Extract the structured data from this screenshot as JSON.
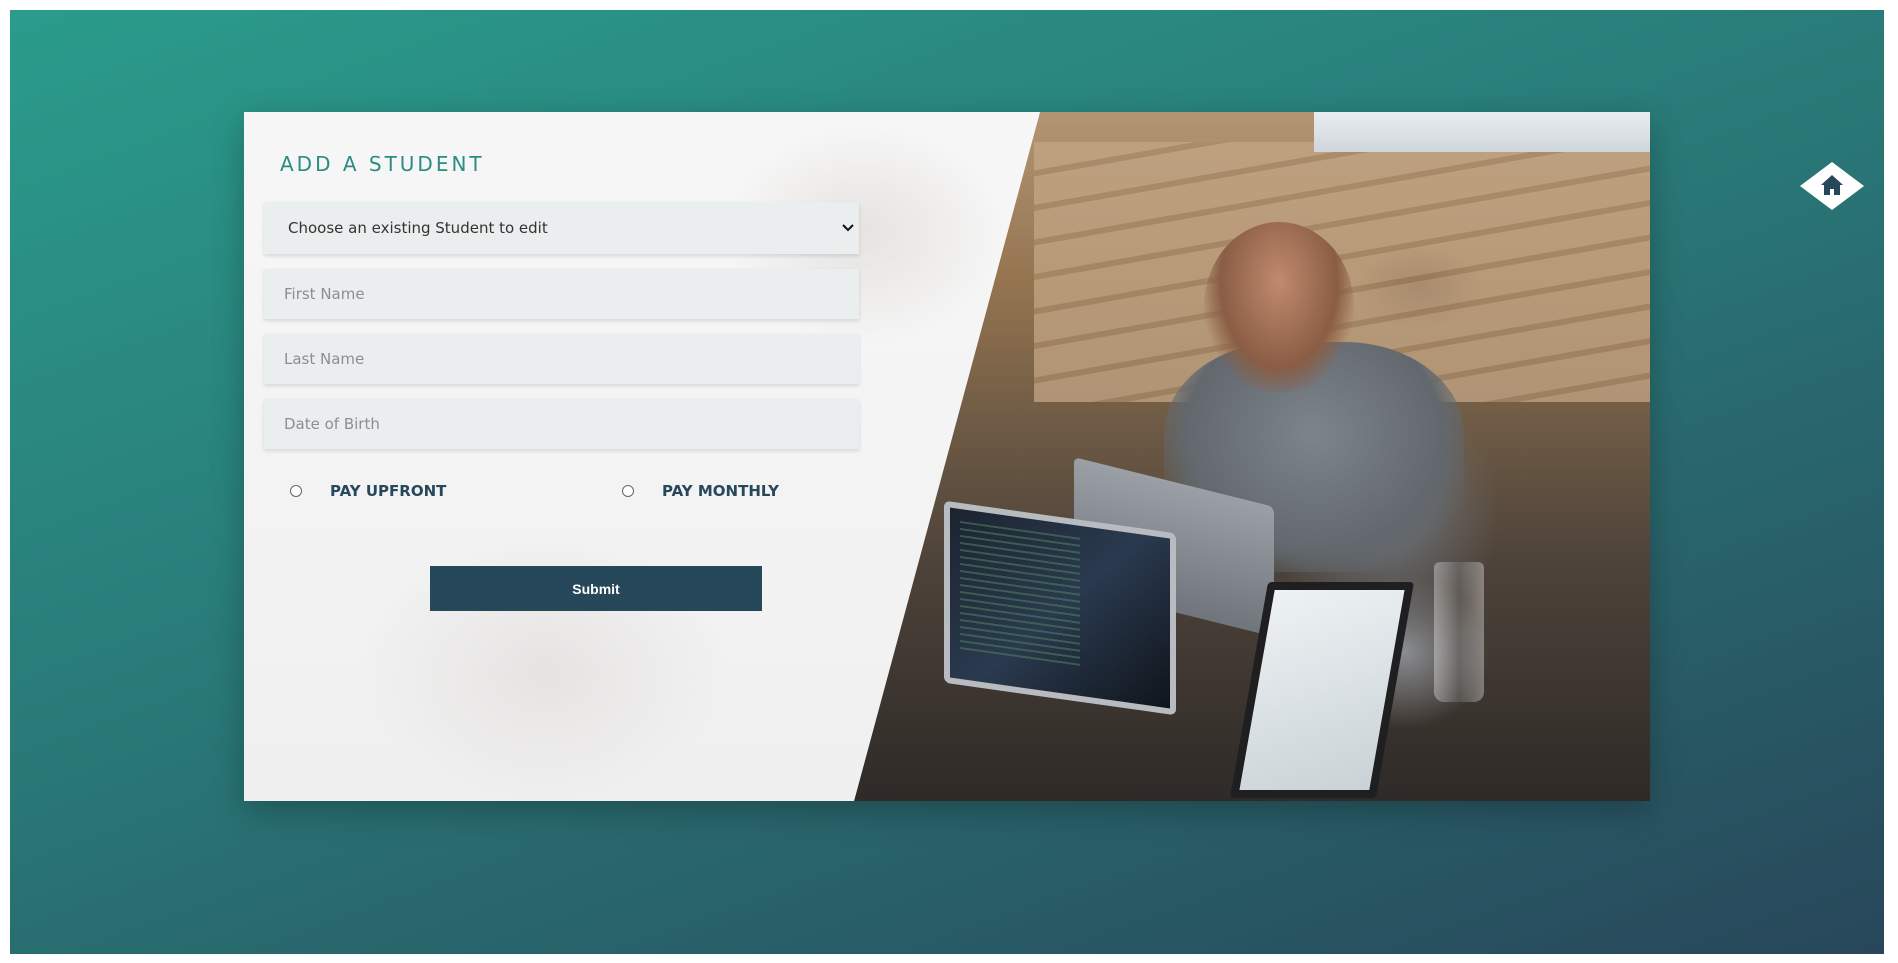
{
  "form": {
    "title": "ADD A STUDENT",
    "student_select": {
      "selected": "Choose an existing Student to edit"
    },
    "first_name": {
      "placeholder": "First Name",
      "value": ""
    },
    "last_name": {
      "placeholder": "Last Name",
      "value": ""
    },
    "date_of_birth": {
      "placeholder": "Date of Birth",
      "value": ""
    },
    "payment_options": [
      {
        "label": "PAY UPFRONT",
        "checked": false
      },
      {
        "label": "PAY MONTHLY",
        "checked": false
      }
    ],
    "submit_label": "Submit"
  },
  "nav": {
    "home_icon": "home-icon"
  },
  "colors": {
    "accent": "#2a8c82",
    "dark": "#27475a",
    "field_bg": "#ebeeee"
  }
}
